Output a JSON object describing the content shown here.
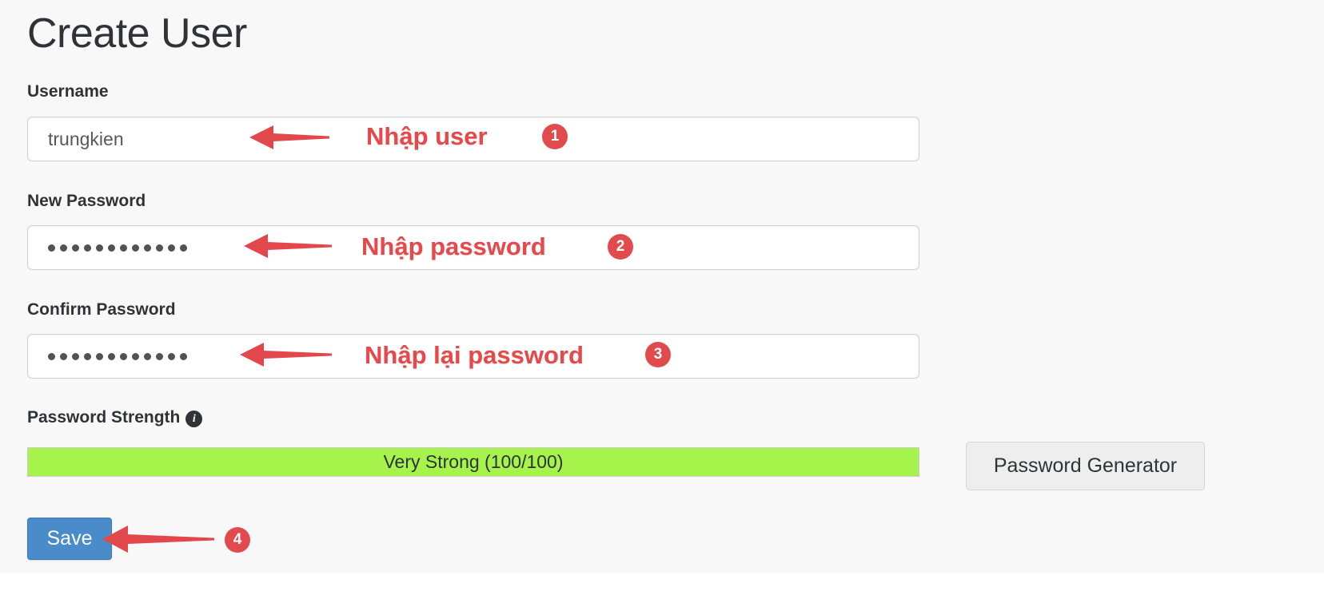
{
  "page": {
    "title": "Create User",
    "background_color": "#f8f8f8"
  },
  "form": {
    "fields": [
      {
        "label": "Username",
        "value": "trungkien",
        "type": "text",
        "masked": false
      },
      {
        "label": "New Password",
        "value": "············",
        "type": "password",
        "masked": true,
        "dot_count": 12
      },
      {
        "label": "Confirm Password",
        "value": "············",
        "type": "password",
        "masked": true,
        "dot_count": 12
      }
    ],
    "strength": {
      "label": "Password Strength",
      "info_icon": "info-icon",
      "info_glyph": "i",
      "bar_text": "Very Strong (100/100)",
      "score": 100,
      "max_score": 100,
      "rating": "Very Strong",
      "bar_color": "#a6f44b",
      "fill_percent": 100
    },
    "save_button": {
      "label": "Save",
      "color": "#4a8bc9"
    }
  },
  "sidebar": {
    "generator_button": {
      "label": "Password Generator"
    }
  },
  "annotations": {
    "accent_color": "#e8484a",
    "badge_color": "#e14b4e",
    "items": [
      {
        "text": "Nhập user",
        "badge": "1",
        "icon": "left-arrow-icon"
      },
      {
        "text": "Nhập password",
        "badge": "2",
        "icon": "left-arrow-icon"
      },
      {
        "text": "Nhập lại password",
        "badge": "3",
        "icon": "left-arrow-icon"
      },
      {
        "text": "",
        "badge": "4",
        "icon": "left-arrow-icon"
      }
    ]
  }
}
